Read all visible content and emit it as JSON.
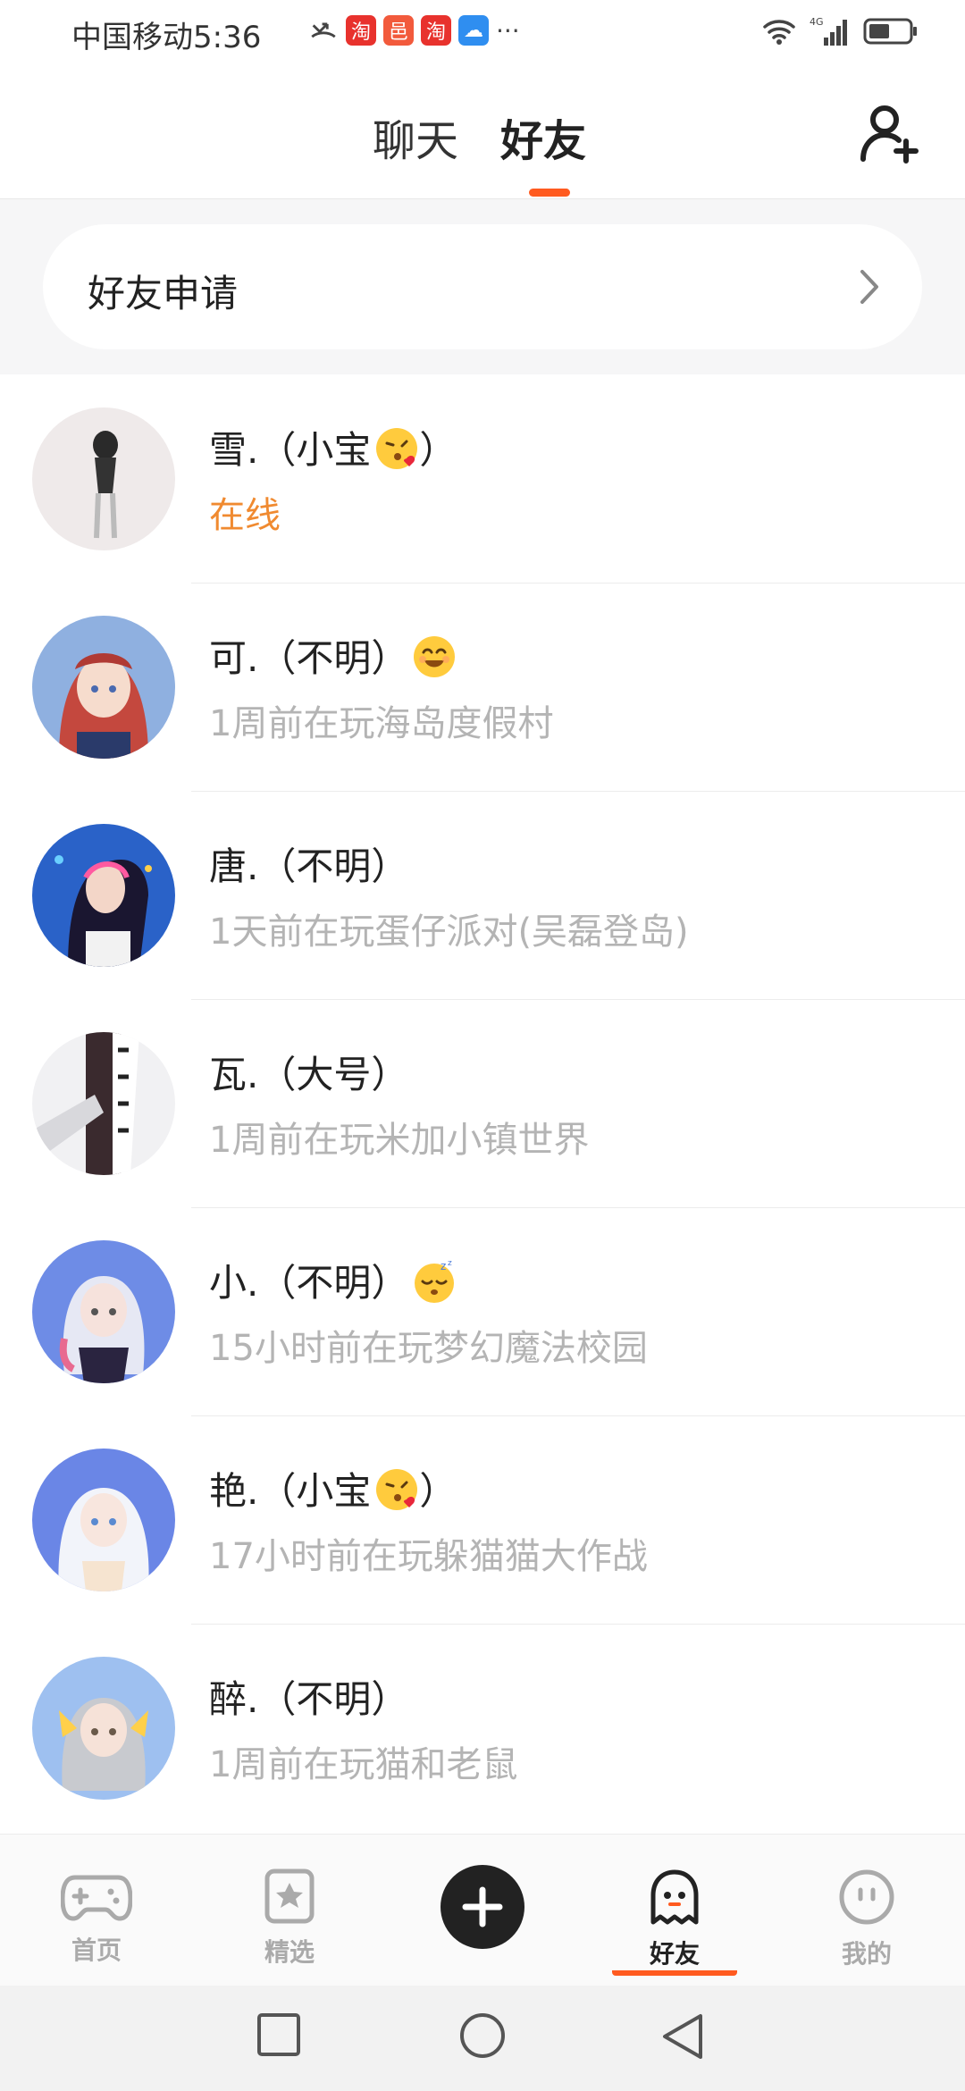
{
  "status_bar": {
    "carrier_time": "中国移动5:36",
    "notif_1": "淘",
    "notif_2": "邑",
    "notif_3": "淘",
    "more": "···",
    "network": "4G"
  },
  "header": {
    "tab_chat": "聊天",
    "tab_friends": "好友",
    "accent_color": "#ff5a1f"
  },
  "friend_request": {
    "label": "好友申请"
  },
  "friends": [
    {
      "name": "雪.（小宝",
      "name_suffix": "）",
      "emoji": "kiss-emoji",
      "status": "在线",
      "online": true
    },
    {
      "name": "可.（不明）",
      "name_suffix": "",
      "emoji": "smile-emoji",
      "status": "1周前在玩海岛度假村",
      "online": false
    },
    {
      "name": "唐.（不明）",
      "name_suffix": "",
      "emoji": "",
      "status": "1天前在玩蛋仔派对(吴磊登岛)",
      "online": false
    },
    {
      "name": "瓦.（大号）",
      "name_suffix": "",
      "emoji": "",
      "status": "1周前在玩米加小镇世界",
      "online": false
    },
    {
      "name": "小.（不明）",
      "name_suffix": "",
      "emoji": "sleepy-emoji",
      "status": "15小时前在玩梦幻魔法校园",
      "online": false
    },
    {
      "name": "艳.（小宝",
      "name_suffix": "）",
      "emoji": "kiss-emoji",
      "status": "17小时前在玩躲猫猫大作战",
      "online": false
    },
    {
      "name": "醉.（不明）",
      "name_suffix": "",
      "emoji": "",
      "status": "1周前在玩猫和老鼠",
      "online": false
    }
  ],
  "bottom_nav": {
    "home": "首页",
    "picks": "精选",
    "friends": "好友",
    "me": "我的",
    "active": "friends"
  }
}
